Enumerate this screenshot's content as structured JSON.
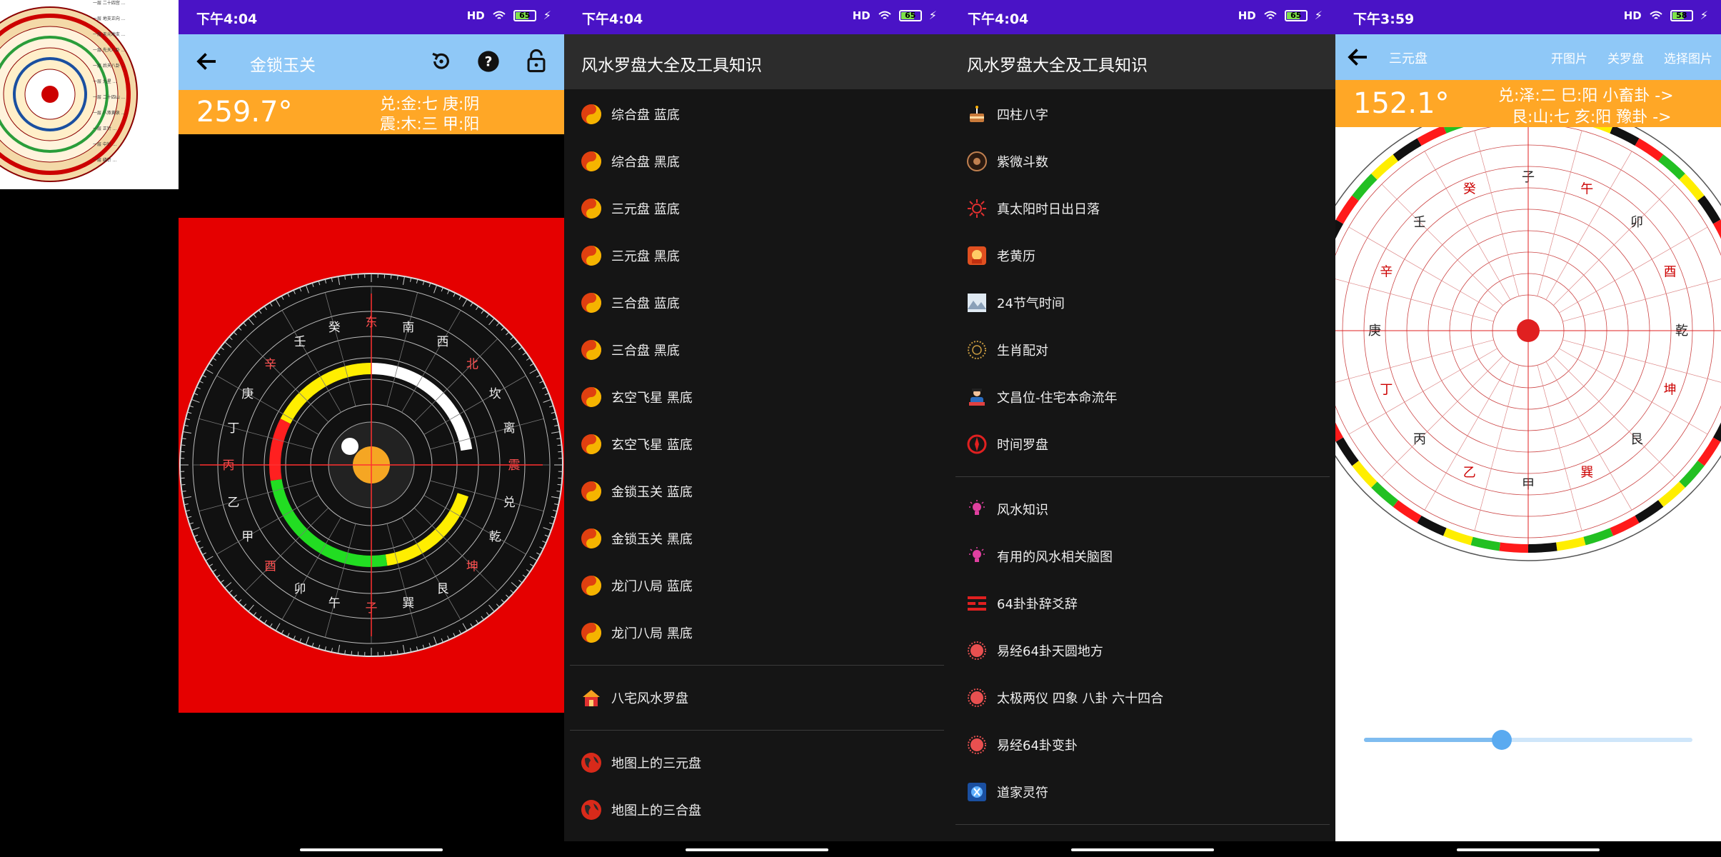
{
  "colors": {
    "status_bar": "#4a13c6",
    "toolbar": "#8fc8f7",
    "readout": "#ffa726",
    "list_bg": "#151515",
    "compass_bg": "#e50000"
  },
  "thumbnail": {
    "lines": [
      "一层 二十四宫 ...",
      "一层 地支正向 ...",
      "一层 天元地支 ...",
      "一层 先天八卦 ...",
      "一层 后天八卦 ...",
      "一层 九星 ...",
      "一层 二十四山 ...",
      "一层 八煞黄泉 ...",
      "一层 正针 ...",
      "一层 中针 ...",
      "一层 缝针 ..."
    ]
  },
  "screen1": {
    "time": "下午4:04",
    "signal": "HD",
    "battery": "65",
    "title": "金锁玉关",
    "degree": "259.7°",
    "line1": "兑:金:七  庚:阴",
    "line2": "震:木:三  甲:阳",
    "compass_labels": [
      "东",
      "南",
      "西",
      "北",
      "坎",
      "离",
      "震",
      "兑",
      "乾",
      "坤",
      "艮",
      "巽",
      "子",
      "午",
      "卯",
      "酉",
      "甲",
      "乙",
      "丙",
      "丁",
      "庚",
      "辛",
      "壬",
      "癸"
    ],
    "icons": {
      "back": "arrow-left",
      "reset": "refresh",
      "help": "question",
      "lock": "lock-open"
    }
  },
  "screen2": {
    "time": "下午4:04",
    "signal": "HD",
    "battery": "65",
    "header": "风水罗盘大全及工具知识",
    "items": [
      {
        "label": "综合盘  蓝底"
      },
      {
        "label": "综合盘  黑底"
      },
      {
        "label": "三元盘  蓝底"
      },
      {
        "label": "三元盘  黑底"
      },
      {
        "label": "三合盘  蓝底"
      },
      {
        "label": "三合盘  黑底"
      },
      {
        "label": "玄空飞星  黑底"
      },
      {
        "label": "玄空飞星  蓝底"
      },
      {
        "label": "金锁玉关  蓝底"
      },
      {
        "label": "金锁玉关  黑底"
      },
      {
        "label": "龙门八局  蓝底"
      },
      {
        "label": "龙门八局  黑底"
      }
    ],
    "item_house": "八宅风水罗盘",
    "items_map": [
      {
        "label": "地图上的三元盘"
      },
      {
        "label": "地图上的三合盘"
      }
    ]
  },
  "screen3": {
    "time": "下午4:04",
    "signal": "HD",
    "battery": "65",
    "header": "风水罗盘大全及工具知识",
    "tools": [
      {
        "label": "四柱八字",
        "icon": "cake-icon"
      },
      {
        "label": "紫微斗数",
        "icon": "star-chart-icon"
      },
      {
        "label": "真太阳时日出日落",
        "icon": "sun-icon"
      },
      {
        "label": "老黄历",
        "icon": "almanac-icon"
      },
      {
        "label": "24节气时间",
        "icon": "landscape-icon"
      },
      {
        "label": "生肖配对",
        "icon": "zodiac-ring-icon"
      },
      {
        "label": "文昌位-住宅本命流年",
        "icon": "scholar-icon"
      },
      {
        "label": "时间罗盘",
        "icon": "compass-icon"
      }
    ],
    "knowledge": [
      {
        "label": "风水知识",
        "icon": "lightbulb-icon"
      },
      {
        "label": "有用的风水相关脑图",
        "icon": "lightbulb-icon"
      },
      {
        "label": "64卦卦辞爻辞",
        "icon": "hexagram-icon"
      },
      {
        "label": "易经64卦天圆地方",
        "icon": "circle-gear-icon"
      },
      {
        "label": "太极两仪  四象   八卦   六十四合",
        "icon": "circle-gear-icon"
      },
      {
        "label": "易经64卦变卦",
        "icon": "circle-gear-icon"
      },
      {
        "label": "道家灵符",
        "icon": "talisman-icon"
      }
    ]
  },
  "screen4": {
    "time": "下午3:59",
    "signal": "HD",
    "battery": "58",
    "title": "三元盘",
    "actions": [
      "开图片",
      "关罗盘",
      "选择图片"
    ],
    "degree": "152.1°",
    "line1": "兑:泽:二  巳:阳  小畜卦  ->",
    "line2": "艮:山:七  亥:阳  豫卦  ->",
    "compass_labels": [
      "子",
      "午",
      "卯",
      "酉",
      "乾",
      "坤",
      "艮",
      "巽",
      "甲",
      "乙",
      "丙",
      "丁",
      "庚",
      "辛",
      "壬",
      "癸"
    ],
    "slider_value": 0.42
  }
}
